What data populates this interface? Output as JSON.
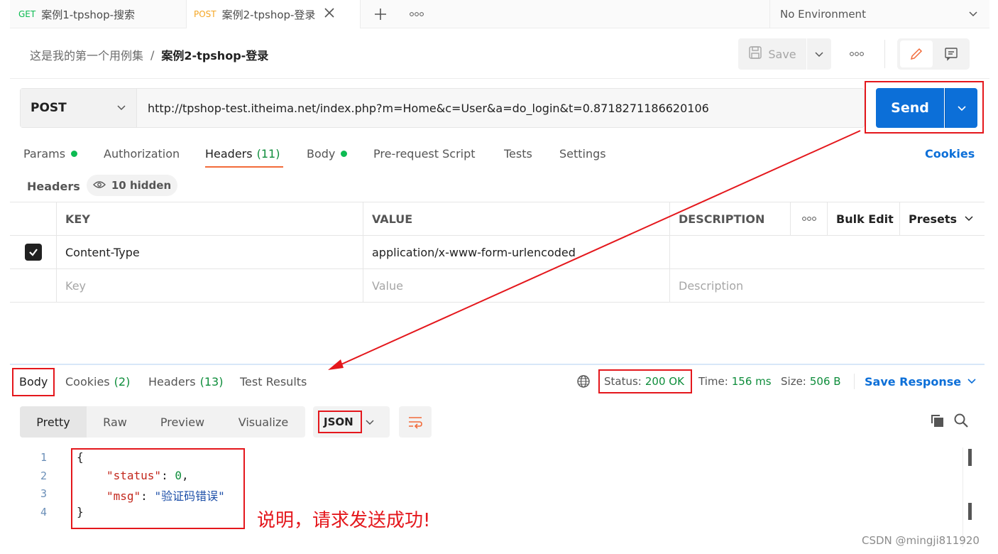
{
  "tabs": [
    {
      "method": "GET",
      "name": "案例1-tpshop-搜索",
      "method_color": "#0cbb52"
    },
    {
      "method": "POST",
      "name": "案例2-tpshop-登录",
      "method_color": "#f5a623"
    }
  ],
  "environment": "No Environment",
  "breadcrumb": {
    "parent": "这是我的第一个用例集",
    "separator": "/",
    "current": "案例2-tpshop-登录"
  },
  "toolbar": {
    "save_label": "Save"
  },
  "request": {
    "method": "POST",
    "url": "http://tpshop-test.itheima.net/index.php?m=Home&c=User&a=do_login&t=0.8718271186620106",
    "send_label": "Send"
  },
  "request_tabs": {
    "params": "Params",
    "authorization": "Authorization",
    "headers": "Headers",
    "headers_count": "(11)",
    "body": "Body",
    "prerequest": "Pre-request Script",
    "tests": "Tests",
    "settings": "Settings",
    "cookies": "Cookies"
  },
  "headers_section": {
    "label": "Headers",
    "hidden": "10 hidden"
  },
  "headers_table": {
    "columns": {
      "key": "KEY",
      "value": "VALUE",
      "description": "DESCRIPTION",
      "bulk_edit": "Bulk Edit",
      "presets": "Presets"
    },
    "rows": [
      {
        "key": "Content-Type",
        "value": "application/x-www-form-urlencoded",
        "description": ""
      }
    ],
    "placeholders": {
      "key": "Key",
      "value": "Value",
      "description": "Description"
    }
  },
  "response_tabs": {
    "body": "Body",
    "cookies": "Cookies",
    "cookies_count": "(2)",
    "headers": "Headers",
    "headers_count": "(13)",
    "test_results": "Test Results"
  },
  "response_meta": {
    "status_label": "Status:",
    "status_value": "200 OK",
    "time_label": "Time:",
    "time_value": "156 ms",
    "size_label": "Size:",
    "size_value": "506 B",
    "save_response": "Save Response"
  },
  "view_modes": [
    "Pretty",
    "Raw",
    "Preview",
    "Visualize"
  ],
  "format": "JSON",
  "code": {
    "line_numbers": [
      "1",
      "2",
      "3",
      "4"
    ],
    "open_brace": "{",
    "close_brace": "}",
    "status_key": "\"status\"",
    "status_value": "0",
    "msg_key": "\"msg\"",
    "msg_value": "\"验证码错误\""
  },
  "annotation": "说明，请求发送成功!",
  "watermark": "CSDN @mingji811920",
  "colors": {
    "accent": "#0c6fd8",
    "annotation": "#e4171c",
    "success": "#0e8d3b",
    "tab_underline": "#f26b3a"
  }
}
